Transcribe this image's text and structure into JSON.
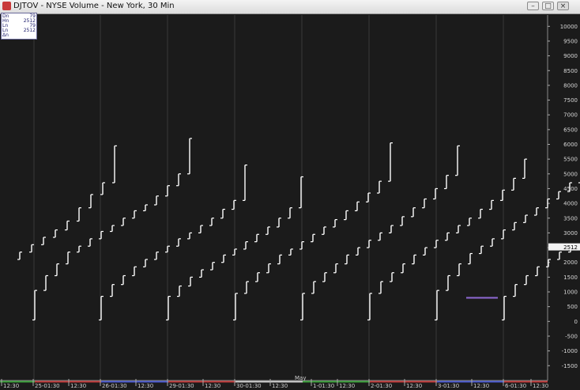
{
  "window": {
    "title": "DJTOV - NYSE Volume - New York, 30 Min",
    "icon": "chart-app-icon",
    "buttons": [
      "minimize",
      "maximize",
      "close"
    ]
  },
  "info_box": [
    {
      "label": "Dn",
      "value": "79"
    },
    {
      "label": "Hn",
      "value": "2512"
    },
    {
      "label": "Ln",
      "value": "79"
    },
    {
      "label": "Ln",
      "value": "2512"
    },
    {
      "label": "Δn",
      "value": ""
    }
  ],
  "current_value_label": "2512",
  "colors": {
    "background": "#1b1b1b",
    "bars": "#ffffff",
    "grid": "#3a3a3a",
    "horizontal_marker": "#8a66cc",
    "session_line_green": "#3aa03a",
    "session_line_red": "#c03a3a",
    "session_line_blue": "#4a5ad0"
  },
  "chart_data": {
    "type": "bar",
    "style": "hlc-step",
    "title": "DJTOV - NYSE Volume - New York, 30 Min",
    "ylim": [
      -1750,
      10500
    ],
    "y_ticks": [
      10000,
      9500,
      9000,
      8500,
      8000,
      7500,
      7000,
      6500,
      6000,
      5500,
      5000,
      4500,
      4000,
      3500,
      3000,
      2500,
      2000,
      1500,
      1000,
      500,
      0,
      -500,
      -1000,
      -1500
    ],
    "y_tick_labels": [
      "10000",
      "9500",
      "9000",
      "8500",
      "8000",
      "7500",
      "7000",
      "6500",
      "6000",
      "5500",
      "5000",
      "4500",
      "4000",
      "3500",
      "3000",
      "2500",
      "2000",
      "1500",
      "1000",
      "500",
      "0",
      "-500",
      "-1000",
      "-1500"
    ],
    "x_tick_labels": [
      "12:30",
      "25-01:30",
      "12:30",
      "26-01:30",
      "12:30",
      "29-01:30",
      "12:30",
      "30-01:30",
      "12:30",
      "May",
      "1-01:30",
      "12:30",
      "2-01:30",
      "12:30",
      "3-01:30",
      "12:30",
      "6-01:30",
      "12:30"
    ],
    "month_label": "May",
    "grid": true,
    "marker_line_value": 800,
    "sessions": [
      {
        "start": 25,
        "step": 15,
        "bars": [
          [
            2100,
            2100,
            2350
          ],
          [
            2350,
            2350,
            2600
          ],
          [
            2600,
            2600,
            2850
          ],
          [
            2850,
            2850,
            3100
          ],
          [
            3100,
            3100,
            3400
          ],
          [
            3400,
            3400,
            3850
          ],
          [
            3850,
            3850,
            4300
          ],
          [
            4300,
            4300,
            4700
          ],
          [
            4700,
            4700,
            5950
          ]
        ]
      },
      {
        "start": 44,
        "step": 14,
        "bars": [
          [
            50,
            50,
            1050
          ],
          [
            1050,
            1050,
            1550
          ],
          [
            1550,
            1550,
            1950
          ],
          [
            1950,
            1950,
            2350
          ],
          [
            2350,
            2350,
            2550
          ],
          [
            2550,
            2550,
            2800
          ],
          [
            2800,
            2800,
            3050
          ],
          [
            3050,
            3050,
            3250
          ],
          [
            3250,
            3250,
            3500
          ],
          [
            3500,
            3500,
            3750
          ],
          [
            3750,
            3750,
            3950
          ],
          [
            3950,
            3950,
            4250
          ],
          [
            4250,
            4250,
            4600
          ],
          [
            4600,
            4600,
            5000
          ],
          [
            5000,
            5000,
            6200
          ]
        ]
      },
      {
        "start": 128,
        "step": 14,
        "bars": [
          [
            50,
            50,
            850
          ],
          [
            850,
            850,
            1250
          ],
          [
            1250,
            1250,
            1550
          ],
          [
            1550,
            1550,
            1850
          ],
          [
            1850,
            1850,
            2100
          ],
          [
            2100,
            2100,
            2350
          ],
          [
            2350,
            2350,
            2550
          ],
          [
            2550,
            2550,
            2800
          ],
          [
            2800,
            2800,
            3000
          ],
          [
            3000,
            3000,
            3250
          ],
          [
            3250,
            3250,
            3500
          ],
          [
            3500,
            3500,
            3800
          ],
          [
            3800,
            3800,
            4100
          ],
          [
            4100,
            4100,
            5300
          ]
        ]
      },
      {
        "start": 213,
        "step": 14,
        "bars": [
          [
            50,
            50,
            850
          ],
          [
            850,
            850,
            1200
          ],
          [
            1200,
            1200,
            1500
          ],
          [
            1500,
            1500,
            1750
          ],
          [
            1750,
            1750,
            2000
          ],
          [
            2000,
            2000,
            2250
          ],
          [
            2250,
            2250,
            2450
          ],
          [
            2450,
            2450,
            2700
          ],
          [
            2700,
            2700,
            2950
          ],
          [
            2950,
            2950,
            3200
          ],
          [
            3200,
            3200,
            3500
          ],
          [
            3500,
            3500,
            3850
          ],
          [
            3850,
            3850,
            4900
          ]
        ]
      },
      {
        "start": 298,
        "step": 14,
        "bars": [
          [
            50,
            50,
            950
          ],
          [
            950,
            950,
            1350
          ],
          [
            1350,
            1350,
            1650
          ],
          [
            1650,
            1650,
            1950
          ],
          [
            1950,
            1950,
            2250
          ],
          [
            2250,
            2250,
            2450
          ],
          [
            2450,
            2450,
            2700
          ],
          [
            2700,
            2700,
            2950
          ],
          [
            2950,
            2950,
            3200
          ],
          [
            3200,
            3200,
            3450
          ],
          [
            3450,
            3450,
            3750
          ],
          [
            3750,
            3750,
            4050
          ],
          [
            4050,
            4050,
            4350
          ],
          [
            4350,
            4350,
            4750
          ],
          [
            4750,
            4750,
            6050
          ]
        ]
      },
      {
        "start": 383,
        "step": 14,
        "bars": [
          [
            50,
            50,
            950
          ],
          [
            950,
            950,
            1350
          ],
          [
            1350,
            1350,
            1650
          ],
          [
            1650,
            1650,
            1950
          ],
          [
            1950,
            1950,
            2250
          ],
          [
            2250,
            2250,
            2500
          ],
          [
            2500,
            2500,
            2750
          ],
          [
            2750,
            2750,
            3000
          ],
          [
            3000,
            3000,
            3250
          ],
          [
            3250,
            3250,
            3550
          ],
          [
            3550,
            3550,
            3850
          ],
          [
            3850,
            3850,
            4150
          ],
          [
            4150,
            4150,
            4500
          ],
          [
            4500,
            4500,
            4950
          ],
          [
            4950,
            4950,
            5950
          ]
        ]
      },
      {
        "start": 468,
        "step": 14,
        "bars": [
          [
            50,
            50,
            950
          ],
          [
            950,
            950,
            1350
          ],
          [
            1350,
            1350,
            1650
          ],
          [
            1650,
            1650,
            1950
          ],
          [
            1950,
            1950,
            2250
          ],
          [
            2250,
            2250,
            2500
          ],
          [
            2500,
            2500,
            2750
          ],
          [
            2750,
            2750,
            3000
          ],
          [
            3000,
            3000,
            3250
          ],
          [
            3250,
            3250,
            3500
          ],
          [
            3500,
            3500,
            3800
          ],
          [
            3800,
            3800,
            4100
          ],
          [
            4100,
            4100,
            4450
          ],
          [
            4450,
            4450,
            4850
          ],
          [
            4850,
            4850,
            5500
          ]
        ]
      },
      {
        "start": 553,
        "step": 14,
        "bars": [
          [
            50,
            50,
            1050
          ],
          [
            1050,
            1050,
            1550
          ],
          [
            1550,
            1550,
            1950
          ],
          [
            1950,
            1950,
            2300
          ],
          [
            2300,
            2300,
            2550
          ],
          [
            2550,
            2550,
            2800
          ],
          [
            2800,
            2800,
            3100
          ],
          [
            3100,
            3100,
            3350
          ],
          [
            3350,
            3350,
            3600
          ],
          [
            3600,
            3600,
            3850
          ],
          [
            3850,
            3850,
            4150
          ],
          [
            4150,
            4150,
            4400
          ],
          [
            4400,
            4400,
            4700
          ],
          [
            4700,
            4700,
            5850
          ]
        ]
      },
      {
        "start": 638,
        "step": 14,
        "bars": [
          [
            50,
            50,
            850
          ],
          [
            850,
            850,
            1250
          ],
          [
            1250,
            1250,
            1550
          ],
          [
            1550,
            1550,
            1850
          ],
          [
            1850,
            1850,
            2100
          ],
          [
            2100,
            2100,
            2350
          ],
          [
            2350,
            2350,
            2512
          ]
        ]
      }
    ]
  }
}
